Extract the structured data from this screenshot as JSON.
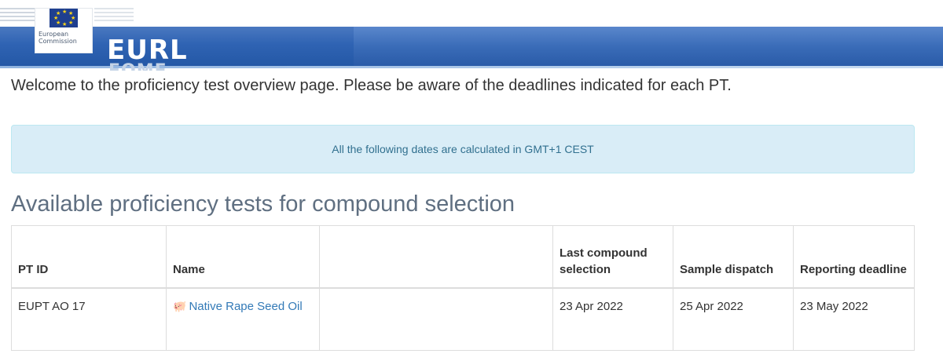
{
  "header": {
    "logo_line1": "European",
    "logo_line2": "Commission",
    "site_title": "EURL",
    "site_subtitle": "FOME"
  },
  "welcome_text": "Welcome to the proficiency test overview page. Please be aware of the deadlines indicated for each PT.",
  "alert_text": "All the following dates are calculated in GMT+1 CEST",
  "section_title": "Available proficiency tests for compound selection",
  "table": {
    "columns": [
      "PT ID",
      "Name",
      "",
      "Last compound selection",
      "Sample dispatch",
      "Reporting deadline"
    ],
    "rows": [
      {
        "pt_id": "EUPT AO 17",
        "name": "Native Rape Seed Oil",
        "name_icon": "piggy-bank-icon",
        "blank": "",
        "last_compound_selection": "23 Apr 2022",
        "sample_dispatch": "25 Apr 2022",
        "reporting_deadline": "23 May 2022"
      }
    ]
  },
  "colors": {
    "header_blue": "#2f63b3",
    "alert_bg": "#d9edf7",
    "alert_text": "#31708f",
    "link": "#337ab7"
  }
}
